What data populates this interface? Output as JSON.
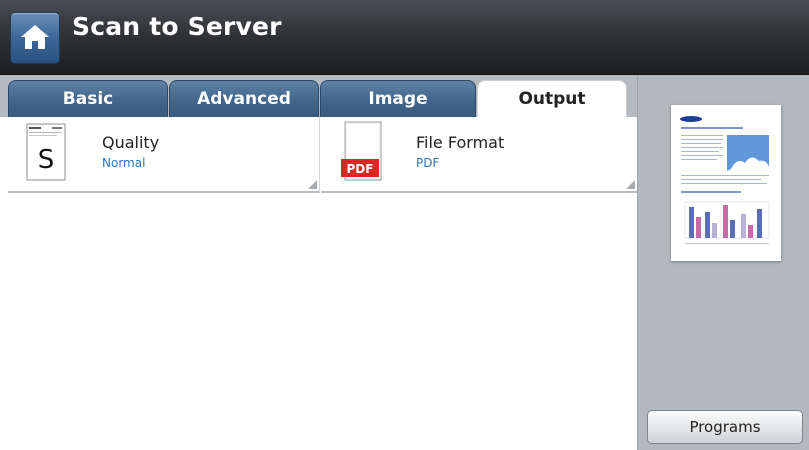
{
  "header": {
    "title": "Scan to Server",
    "home_icon": "home-icon"
  },
  "tabs": [
    {
      "label": "Basic",
      "active": false
    },
    {
      "label": "Advanced",
      "active": false
    },
    {
      "label": "Image",
      "active": false
    },
    {
      "label": "Output",
      "active": true
    }
  ],
  "options": {
    "quality": {
      "label": "Quality",
      "value": "Normal",
      "icon": "quality-document-icon",
      "icon_letter": "S"
    },
    "file_format": {
      "label": "File Format",
      "value": "PDF",
      "icon": "pdf-file-icon",
      "icon_badge": "PDF"
    }
  },
  "side_panel": {
    "preview_icon": "document-preview-thumbnail",
    "programs_label": "Programs"
  },
  "colors": {
    "header_bg": "#2c2e31",
    "tab_bg": "#3f6389",
    "value_text": "#2f74b8",
    "pdf_red": "#d42a22",
    "side_bg": "#b3b8bc"
  }
}
